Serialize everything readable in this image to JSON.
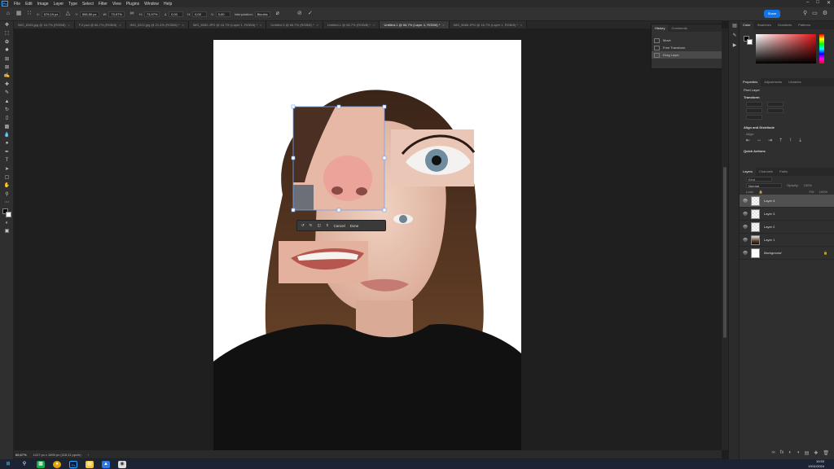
{
  "app": {
    "logo_text": "Ps"
  },
  "menu": [
    "File",
    "Edit",
    "Image",
    "Layer",
    "Type",
    "Select",
    "Filter",
    "View",
    "Plugins",
    "Window",
    "Help"
  ],
  "options_bar": {
    "x_label": "X:",
    "x_value": "579,19 px",
    "y_label": "Y:",
    "y_value": "596,50 px",
    "w_label": "W:",
    "w_value": "73,97%",
    "h_label": "H:",
    "h_value": "73,97%",
    "angle_value": "0,00",
    "h_skew_label": "H:",
    "h_skew_value": "0,00",
    "v_skew_label": "V:",
    "v_skew_value": "0,00",
    "interpolation_label": "Interpolation:",
    "interpolation_value": "Bicubic",
    "share_label": "Share"
  },
  "tabs": [
    {
      "label": "IMG_8165.jpg @ 16,7% (RGB/8)",
      "active": false
    },
    {
      "label": "F.2.psd @ 66,7% (RGB/8)",
      "active": false
    },
    {
      "label": "IMG_8112.jpg @ 21,4% (RGB/8) *",
      "active": false
    },
    {
      "label": "IMG_8082.JPG @ 16,7% (Layer 1, RGB/8) *",
      "active": false
    },
    {
      "label": "Untitled-3 @ 66,7% (RGB/8) *",
      "active": false
    },
    {
      "label": "Untitled-1 @ 66,7% (RGB/8) *",
      "active": false
    },
    {
      "label": "Untitled-1 @ 66,7% (Layer 4, RGB/8) *",
      "active": true
    },
    {
      "label": "IMG_8086.JPG @ 16,7% (Layer 1, RGB/8) *",
      "active": false
    }
  ],
  "history": {
    "tabs": [
      "History",
      "Comments"
    ],
    "items": [
      "Move",
      "Free Transform",
      "Drag Layer"
    ],
    "selected": "Drag Layer"
  },
  "transform_bar": {
    "cancel": "Cancel",
    "done": "Done"
  },
  "color_panel": {
    "tabs": [
      "Color",
      "Swatches",
      "Gradients",
      "Patterns"
    ]
  },
  "properties": {
    "tabs": [
      "Properties",
      "Adjustments",
      "Libraries"
    ],
    "layer_type": "Pixel Layer",
    "transform_title": "Transform",
    "align_title": "Align and Distribute",
    "align_label": "Align:",
    "quick_actions_title": "Quick Actions"
  },
  "layers_panel": {
    "tabs": [
      "Layers",
      "Channels",
      "Paths"
    ],
    "search_placeholder": "Kind",
    "blend_mode": "Normal",
    "opacity_label": "Opacity:",
    "opacity_value": "100%",
    "lock_label": "Lock:",
    "fill_label": "Fill:",
    "fill_value": "100%",
    "layers": [
      {
        "name": "Layer 4",
        "selected": true,
        "thumb": "checker"
      },
      {
        "name": "Layer 3",
        "selected": false,
        "thumb": "checker"
      },
      {
        "name": "Layer 2",
        "selected": false,
        "thumb": "checker"
      },
      {
        "name": "Layer 1",
        "selected": false,
        "thumb": "photo"
      },
      {
        "name": "Background",
        "selected": false,
        "thumb": "white"
      }
    ]
  },
  "status": {
    "zoom": "66,67%",
    "doc_info": "1417 px x 1890 px (118,11 ppcm)"
  },
  "taskbar": {
    "time": "10:53",
    "date": "19/11/2024"
  },
  "colors": {
    "accent": "#1473e6",
    "fg_swatch": "#000000",
    "bg_swatch": "#ffffff"
  }
}
